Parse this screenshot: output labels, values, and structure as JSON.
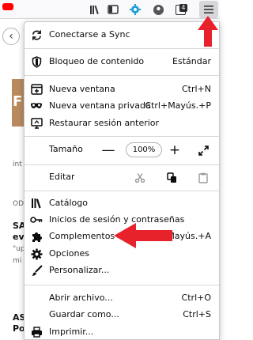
{
  "toolbar": {
    "icons": [
      "library-icon",
      "sidebar-icon",
      "gear-extension-icon",
      "privacy-extension-icon",
      "menu-icon"
    ],
    "badge": "4"
  },
  "page": {
    "snippets": [
      "int",
      "OD",
      "SA",
      "ev",
      "\"up",
      "mi",
      "AS",
      "Po"
    ]
  },
  "menu": {
    "sync": {
      "label": "Conectarse a Sync"
    },
    "content_blocking": {
      "label": "Bloqueo de contenido",
      "value": "Estándar"
    },
    "new_window": {
      "label": "Nueva ventana",
      "shortcut": "Ctrl+N"
    },
    "private_window": {
      "label": "Nueva ventana privada",
      "shortcut": "Ctrl+Mayús.+P"
    },
    "restore_session": {
      "label": "Restaurar sesión anterior"
    },
    "zoom": {
      "label": "Tamaño",
      "minus": "—",
      "value": "100%",
      "plus": "+"
    },
    "edit": {
      "label": "Editar"
    },
    "catalog": {
      "label": "Catálogo"
    },
    "logins": {
      "label": "Inicios de sesión y contraseñas"
    },
    "addons": {
      "label": "Complementos",
      "shortcut": "Mayús.+A"
    },
    "options": {
      "label": "Opciones"
    },
    "customize": {
      "label": "Personalizar..."
    },
    "open_file": {
      "label": "Abrir archivo...",
      "shortcut": "Ctrl+O"
    },
    "save_as": {
      "label": "Guardar como...",
      "shortcut": "Ctrl+S"
    },
    "print": {
      "label": "Imprimir..."
    }
  },
  "annotations": {
    "arrow_color": "#e8222b"
  }
}
